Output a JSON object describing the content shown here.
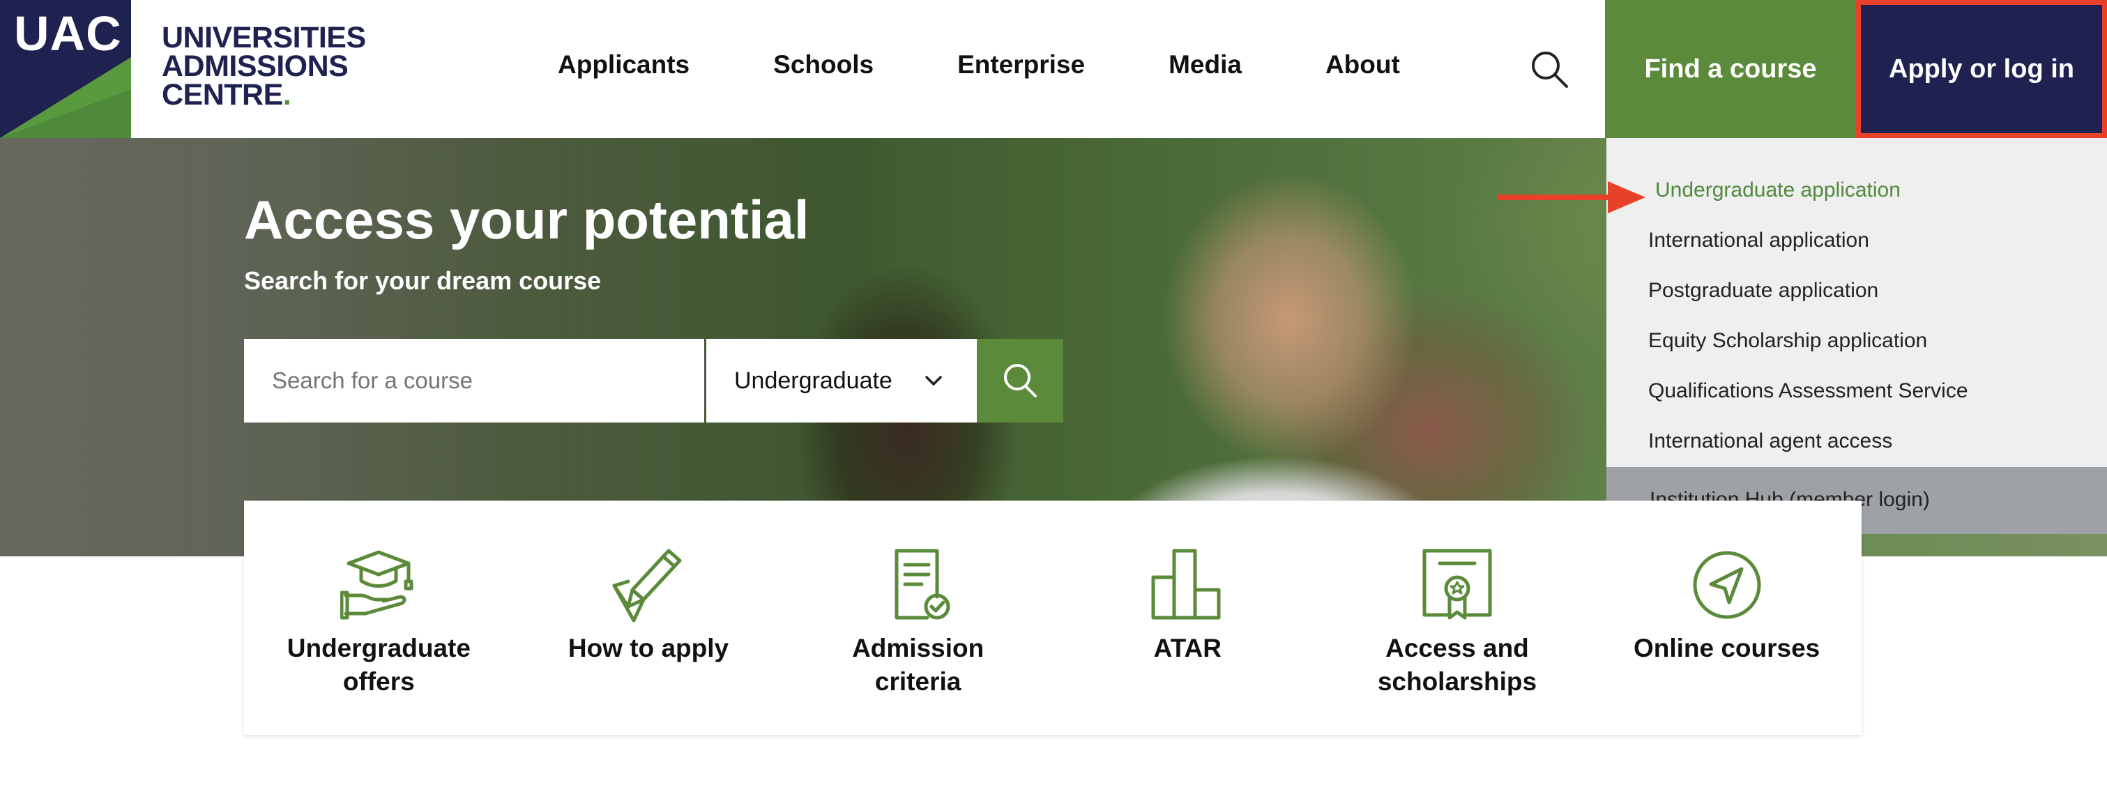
{
  "logo": {
    "mark": "UAC",
    "line1": "UNIVERSITIES",
    "line2": "ADMISSIONS",
    "line3": "CENTRE",
    "dot": "."
  },
  "nav": {
    "items": [
      "Applicants",
      "Schools",
      "Enterprise",
      "Media",
      "About"
    ]
  },
  "header": {
    "search_icon": "search-icon",
    "find_course": "Find a course",
    "apply_login": "Apply or log in"
  },
  "hero": {
    "title": "Access your potential",
    "subtitle": "Search for your dream course",
    "search": {
      "placeholder": "Search for a course",
      "value": "",
      "level_selected": "Undergraduate"
    }
  },
  "dropdown": {
    "items": [
      "Undergraduate application",
      "International application",
      "Postgraduate application",
      "Equity Scholarship application",
      "Qualifications Assessment Service",
      "International agent access"
    ],
    "hub": "Institution Hub (member login)",
    "active_index": 0
  },
  "quick_links": [
    {
      "label1": "Undergraduate",
      "label2": "offers",
      "icon": "graduation-cap-hand-icon"
    },
    {
      "label1": "How to apply",
      "label2": "",
      "icon": "pencil-icon"
    },
    {
      "label1": "Admission",
      "label2": "criteria",
      "icon": "document-check-icon"
    },
    {
      "label1": "ATAR",
      "label2": "",
      "icon": "bar-chart-icon"
    },
    {
      "label1": "Access and",
      "label2": "scholarships",
      "icon": "certificate-icon"
    },
    {
      "label1": "Online courses",
      "label2": "",
      "icon": "compass-icon"
    }
  ],
  "colors": {
    "navy": "#1f2150",
    "green": "#5a8a3a",
    "highlight": "#e8412a",
    "dropdown_bg": "#efefef",
    "hub_bg": "#9ea2a6"
  }
}
